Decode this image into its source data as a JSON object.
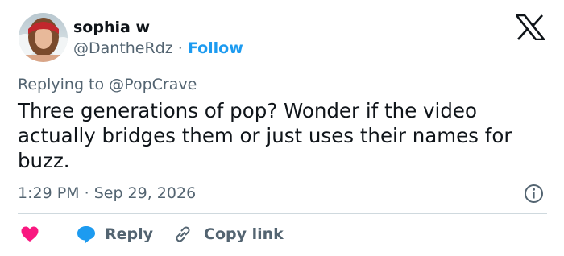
{
  "author": {
    "name": "sophia w",
    "handle": "@DantheRdz",
    "separator": "·",
    "follow_label": "Follow"
  },
  "reply_context": {
    "prefix": "Replying to",
    "mention": "@PopCrave"
  },
  "tweet": {
    "text": "Three generations of pop? Wonder if the video actually bridges them or just uses their names for buzz.",
    "time": "1:29 PM",
    "separator": "·",
    "date": "Sep 29, 2026"
  },
  "actions": {
    "like_icon": "heart-icon",
    "reply_label": "Reply",
    "reply_icon": "speech-bubble-icon",
    "copy_label": "Copy link",
    "copy_icon": "link-icon"
  },
  "colors": {
    "accent": "#1d9bf0",
    "like": "#f91880",
    "secondary_text": "#536471",
    "primary_text": "#0f1419",
    "divider": "#cfd9de"
  },
  "icons": {
    "brand": "x-logo-icon",
    "info": "info-icon"
  }
}
